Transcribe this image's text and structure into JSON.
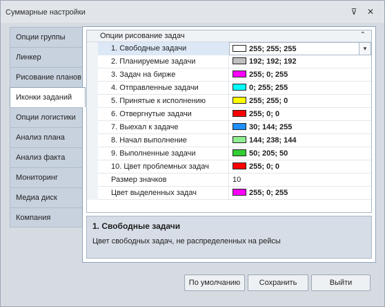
{
  "window": {
    "title": "Суммарные настройки",
    "pin_glyph": "⊽",
    "close_glyph": "✕"
  },
  "nav": {
    "items": [
      {
        "label": "Опции группы",
        "active": false
      },
      {
        "label": "Линкер",
        "active": false
      },
      {
        "label": "Рисование планов",
        "active": false
      },
      {
        "label": "Иконки заданий",
        "active": true
      },
      {
        "label": "Опции логистики",
        "active": false
      },
      {
        "label": "Анализ плана",
        "active": false
      },
      {
        "label": "Анализ факта",
        "active": false
      },
      {
        "label": "Мониторинг",
        "active": false
      },
      {
        "label": "Медиа диск",
        "active": false
      },
      {
        "label": "Компания",
        "active": false
      }
    ]
  },
  "grid": {
    "category": "Опции рисование задач",
    "collapse_glyph": "⌃",
    "dropdown_glyph": "▾",
    "rows": [
      {
        "name": "1. Свободные задачи",
        "value": "255; 255; 255",
        "color": "#ffffff",
        "selected": true
      },
      {
        "name": "2. Планируемые задачи",
        "value": "192; 192; 192",
        "color": "#c0c0c0"
      },
      {
        "name": "3. Задач на бирже",
        "value": "255; 0; 255",
        "color": "#ff00ff"
      },
      {
        "name": "4. Отправленные задачи",
        "value": "0; 255; 255",
        "color": "#00ffff"
      },
      {
        "name": "5. Принятые к исполнению",
        "value": "255; 255; 0",
        "color": "#ffff00"
      },
      {
        "name": "6. Отвергнутые задачи",
        "value": "255; 0; 0",
        "color": "#ff0000"
      },
      {
        "name": "7. Выехал к задаче",
        "value": "30; 144; 255",
        "color": "#1e90ff"
      },
      {
        "name": "8. Начал выполнение",
        "value": "144; 238; 144",
        "color": "#90ee90"
      },
      {
        "name": "9. Выполненные задачи",
        "value": "50; 205; 50",
        "color": "#32cd32"
      },
      {
        "name": "10. Цвет проблемных задач",
        "value": "255; 0; 0",
        "color": "#ff0000"
      },
      {
        "name": "Размер значков",
        "value": "10",
        "color": null
      },
      {
        "name": "Цвет выделенных задач",
        "value": "255; 0; 255",
        "color": "#ff00ff"
      }
    ]
  },
  "description": {
    "title": "1. Свободные задачи",
    "text": "Цвет свободных задач, не распределенных на рейсы"
  },
  "buttons": {
    "default_label": "По умолчанию",
    "save_label": "Сохранить",
    "exit_label": "Выйти"
  }
}
